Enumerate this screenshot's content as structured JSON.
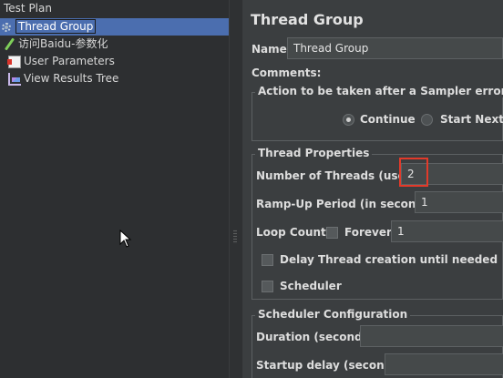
{
  "tree": {
    "items": [
      {
        "label": "Test Plan",
        "icon": "test-plan"
      },
      {
        "label": "Thread Group",
        "icon": "gear-icon",
        "selected": true
      },
      {
        "label": "访问Baidu-参数化",
        "icon": "pipette-icon"
      },
      {
        "label": "User Parameters",
        "icon": "param-icon"
      },
      {
        "label": "View Results Tree",
        "icon": "tree-view-icon"
      }
    ]
  },
  "panel": {
    "title": "Thread Group",
    "name_label": "Name:",
    "name_value": "Thread Group",
    "comments_label": "Comments:",
    "sampler_error": {
      "legend": "Action to be taken after a Sampler error",
      "continue_label": "Continue",
      "start_next_label": "Start Next T"
    },
    "thread_properties": {
      "legend": "Thread Properties",
      "threads_label": "Number of Threads (users):",
      "threads_value": "2",
      "rampup_label": "Ramp-Up Period (in seconds):",
      "rampup_value": "1",
      "loop_label": "Loop Count:",
      "forever_label": "Forever",
      "loop_value": "1",
      "delay_label": "Delay Thread creation until needed",
      "scheduler_label": "Scheduler"
    },
    "scheduler_config": {
      "legend": "Scheduler Configuration",
      "duration_label": "Duration (seconds)",
      "startup_label": "Startup delay (seconds)"
    }
  },
  "colors": {
    "selection": "#4b6eaf",
    "highlight": "#e23a2a"
  }
}
